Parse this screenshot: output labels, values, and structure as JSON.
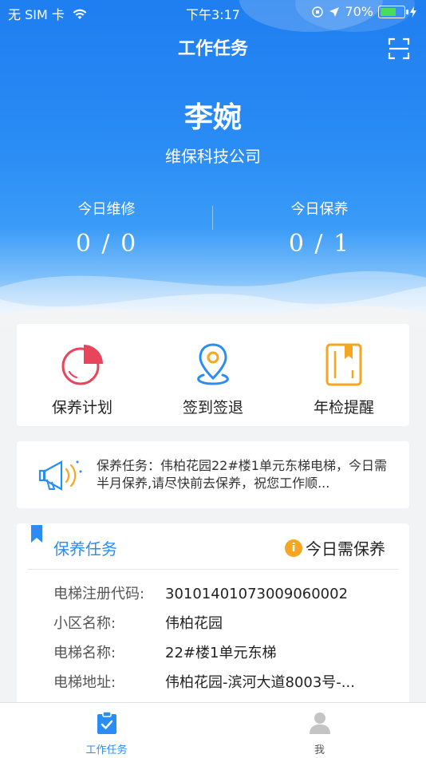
{
  "status_bar": {
    "carrier": "无 SIM 卡",
    "time": "下午3:17",
    "battery_percent": "70%"
  },
  "header": {
    "title": "工作任务"
  },
  "user": {
    "name": "李婉",
    "company": "维保科技公司"
  },
  "stats": {
    "repair_label": "今日维修",
    "repair_value": "0 / 0",
    "maintenance_label": "今日保养",
    "maintenance_value": "0 / 1"
  },
  "quick_actions": [
    {
      "label": "保养计划",
      "icon": "pie-chart-icon"
    },
    {
      "label": "签到签退",
      "icon": "location-pin-icon"
    },
    {
      "label": "年检提醒",
      "icon": "notebook-icon"
    }
  ],
  "notice": {
    "icon": "megaphone-icon",
    "text": "保养任务：伟柏花园22#楼1单元东梯电梯，今日需半月保养,请尽快前去保养，祝您工作顺..."
  },
  "task_card": {
    "title": "保养任务",
    "status": "今日需保养",
    "rows": [
      {
        "key": "电梯注册代码:",
        "value": "30101401073009060002"
      },
      {
        "key": "小区名称:",
        "value": "伟柏花园"
      },
      {
        "key": "电梯名称:",
        "value": "22#楼1单元东梯"
      },
      {
        "key": "电梯地址:",
        "value": "伟柏花园-滨河大道8003号-..."
      }
    ]
  },
  "tab_bar": {
    "tabs": [
      {
        "label": "工作任务",
        "active": true
      },
      {
        "label": "我",
        "active": false
      }
    ]
  },
  "colors": {
    "primary": "#2a8cf5",
    "red": "#e8455c",
    "orange": "#f5a623"
  }
}
